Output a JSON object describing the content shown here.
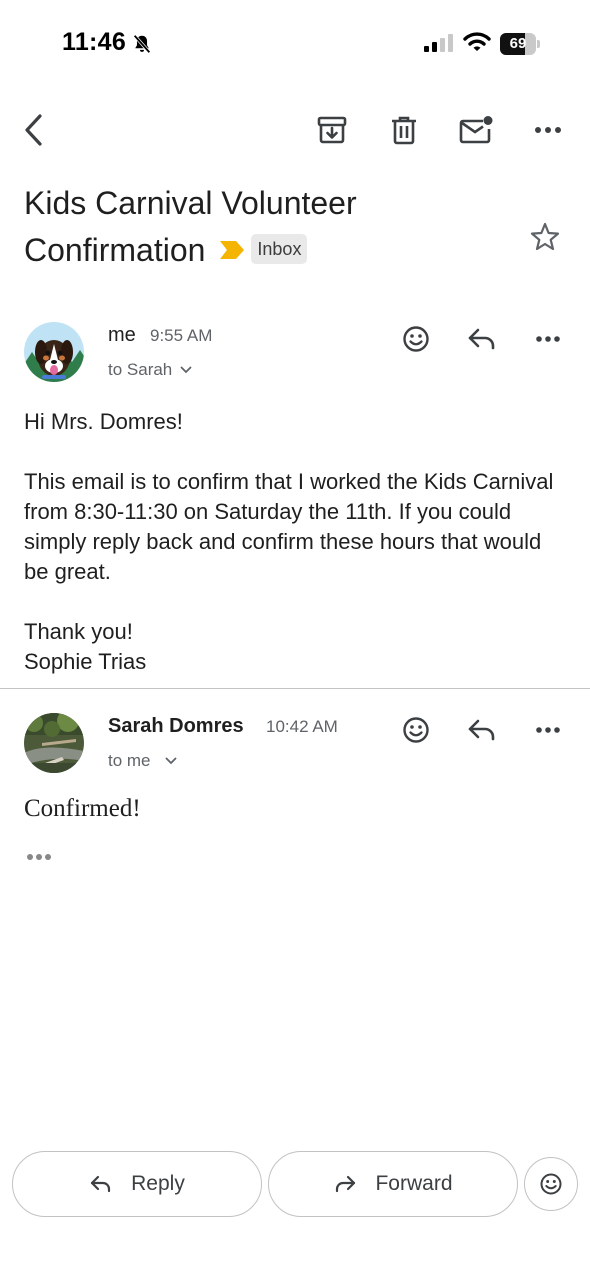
{
  "status_bar": {
    "time": "11:46",
    "battery": "69",
    "battery_level": 0.69,
    "icons": [
      "bell-slash-icon",
      "cellular-signal-icon",
      "wifi-icon",
      "battery-icon"
    ]
  },
  "toolbar": {
    "icons": [
      "back-chevron-icon",
      "archive-icon",
      "trash-icon",
      "mark-unread-icon",
      "more-vertical-dots-icon"
    ]
  },
  "subject": {
    "text": "Kids Carnival Volunteer Confirmation",
    "label": "Inbox",
    "importance_color": "#f4b400"
  },
  "messages": [
    {
      "sender": "me",
      "time": "9:55 AM",
      "recipient": "to Sarah",
      "body": [
        "Hi Mrs. Domres!",
        "This email is to confirm that I worked the Kids Carnival from 8:30-11:30 on Saturday the 11th. If you could simply reply back and confirm these hours that would be great.",
        "Thank you!",
        "Sophie Trias"
      ]
    },
    {
      "sender": "Sarah Domres",
      "time": "10:42 AM",
      "recipient": "to me",
      "body": "Confirmed!",
      "trimmed_content_icon": "more-horizontal-dots-icon"
    }
  ],
  "actions": {
    "reply": "Reply",
    "forward": "Forward"
  }
}
